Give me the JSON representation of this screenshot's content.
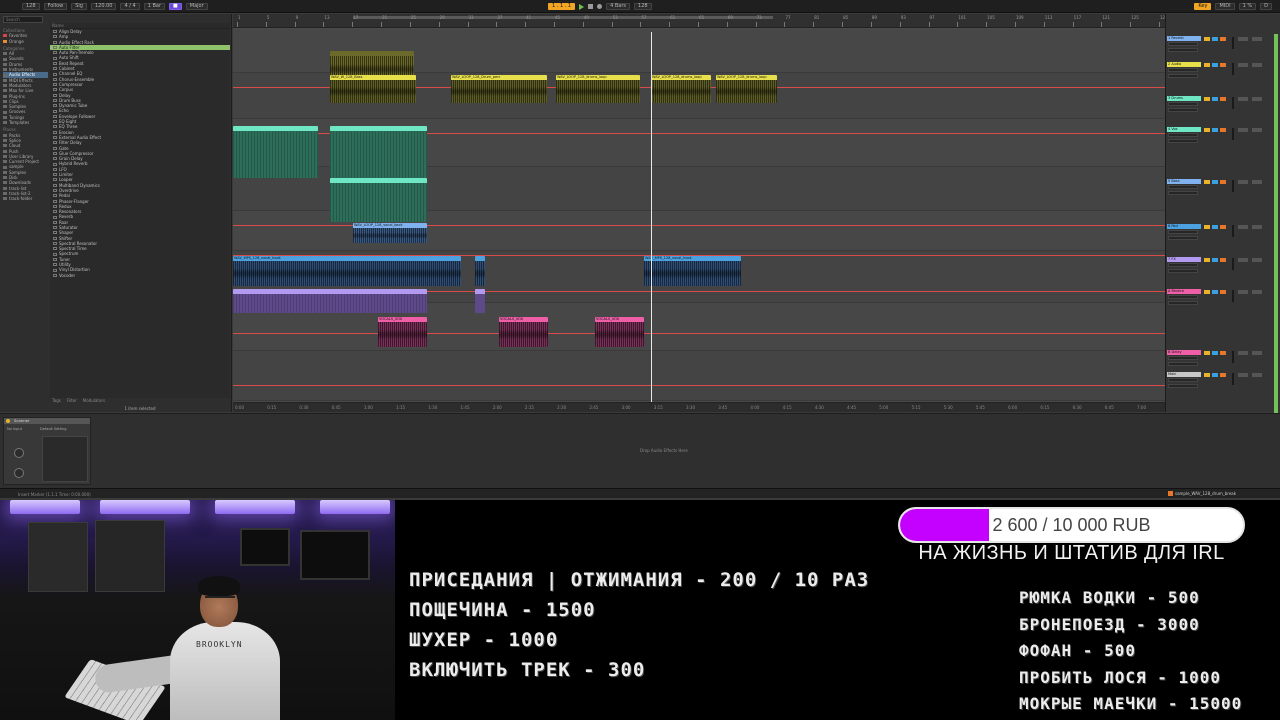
{
  "daw": {
    "transport": {
      "tempo": "128",
      "bars": "1 . 1 . 1",
      "zoom": "4 Bars"
    },
    "topbar": {
      "left_items": [
        "128",
        "Follow",
        "Sig",
        "120.00",
        "4 / 4",
        "1 Bar",
        "Major"
      ],
      "right_items": [
        "Key",
        "MIDI",
        "1 %",
        "D"
      ]
    },
    "browser": {
      "search_placeholder": "Search",
      "places_header": "Collections",
      "collections": [
        "Favorites",
        "Orange"
      ],
      "categories_header": "Categories",
      "categories": [
        "All",
        "Sounds",
        "Drums",
        "Instruments",
        "Audio Effects",
        "MIDI Effects",
        "Modulators",
        "Max for Live",
        "Plug-Ins",
        "Clips",
        "Samples",
        "Grooves",
        "Tunings",
        "Templates"
      ],
      "places2_header": "Places",
      "places": [
        "Packs",
        "Splice",
        "Cloud",
        "Push",
        "User Library",
        "Current Project",
        "sample",
        "Samples",
        "Disk",
        "Downloads",
        "track-list",
        "track-list-2",
        "track-folder"
      ],
      "files_header": "Name",
      "files": [
        "Align Delay",
        "Amp",
        "Audio Effect Rack",
        "Auto Filter",
        "Auto Pan-Tremolo",
        "Auto Shift",
        "Beat Repeat",
        "Cabinet",
        "Channel EQ",
        "Chorus-Ensemble",
        "Compressor",
        "Corpus",
        "Delay",
        "Drum Buss",
        "Dynamic Tube",
        "Echo",
        "Envelope Follower",
        "EQ Eight",
        "EQ Three",
        "Erosion",
        "External Audio Effect",
        "Filter Delay",
        "Gate",
        "Glue Compressor",
        "Grain Delay",
        "Hybrid Reverb",
        "LFO",
        "Limiter",
        "Looper",
        "Multiband Dynamics",
        "Overdrive",
        "Pedal",
        "Phaser-Flanger",
        "Redux",
        "Resonators",
        "Reverb",
        "Roar",
        "Saturator",
        "Shaper",
        "Shifter",
        "Spectral Resonator",
        "Spectral Time",
        "Spectrum",
        "Tuner",
        "Utility",
        "Vinyl Distortion",
        "Vocoder"
      ],
      "selected_file_index": 3,
      "footer_tabs": [
        "Tags",
        "Filter",
        "Modulators"
      ],
      "status": "1 item selected"
    },
    "ruler": {
      "bars": [
        "1",
        "5",
        "9",
        "13",
        "17",
        "21",
        "25",
        "29",
        "33",
        "37",
        "41",
        "45",
        "49",
        "53",
        "57",
        "61",
        "65",
        "69",
        "73",
        "77",
        "81",
        "85",
        "89",
        "93",
        "97",
        "101",
        "105",
        "109",
        "113",
        "117",
        "121",
        "125",
        "129"
      ]
    },
    "time_ruler": [
      "0:00",
      "0:15",
      "0:30",
      "0:45",
      "1:00",
      "1:15",
      "1:30",
      "1:45",
      "2:00",
      "2:15",
      "2:30",
      "2:45",
      "3:00",
      "3:15",
      "3:30",
      "3:45",
      "4:00",
      "4:15",
      "4:30",
      "4:45",
      "5:00",
      "5:15",
      "5:30",
      "5:45",
      "6:00",
      "6:15",
      "6:30",
      "6:45",
      "7:00"
    ],
    "clips": {
      "a1": "WAV_W_128_Bass",
      "a2": "WAV_LOOP_128_Drum_perc",
      "a3": "WAV_LOOP_128_drums_loop",
      "a4": "WAV_LOOP_128_drums_loop",
      "a5": "WAV_LOOP_128_vocal_back",
      "a6": "WAV_MPS_128_vocal_hook",
      "a7": "VOCALS_VOX",
      "a8": "VOCALS_VOX",
      "a9": "VOCALS_VOX"
    },
    "mixer_tracks": [
      "1 Reverb",
      "2 Audio",
      "3 Drums",
      "4 Vox",
      "5 Bass",
      "6 Pad",
      "7 FX",
      "A Reverb",
      "B Delay",
      "Main"
    ],
    "mixer_labels": {
      "input": "All Ins",
      "routing": "Track Volume",
      "monitor": "Auto",
      "send": "Master"
    },
    "device": {
      "name": "Scanner",
      "preset": "Default Setting",
      "input": "No Input"
    },
    "drop_hint": "Drop Audio Effects Here",
    "status_left": "Insert Marker (1.1.1 Time: 0:00.000)",
    "status_right": "sample_WAV_128_drum_break"
  },
  "overlay": {
    "goal": {
      "current": 2600,
      "target": 10000,
      "text": "2 600 / 10 000 RUB",
      "caption": "НА ЖИЗНЬ И ШТАТИВ ДЛЯ IRL",
      "fill_color": "#c400ff"
    },
    "menu_left": [
      "ПРИСЕДАНИЯ | ОТЖИМАНИЯ - 200 / 10 РАЗ",
      "ПОЩЕЧИНА - 1500",
      "ШУХЕР - 1000",
      "ВКЛЮЧИТЬ ТРЕК - 300"
    ],
    "menu_right": [
      "РЮМКА ВОДКИ - 500",
      "БРОНЕПОЕЗД - 3000",
      "ФОФАН - 500",
      "ПРОБИТЬ ЛОСЯ - 1000",
      "МОКРЫЕ МАЕЧКИ - 15000"
    ],
    "webcam": {
      "shirt_text": "BROOKLYN"
    }
  }
}
